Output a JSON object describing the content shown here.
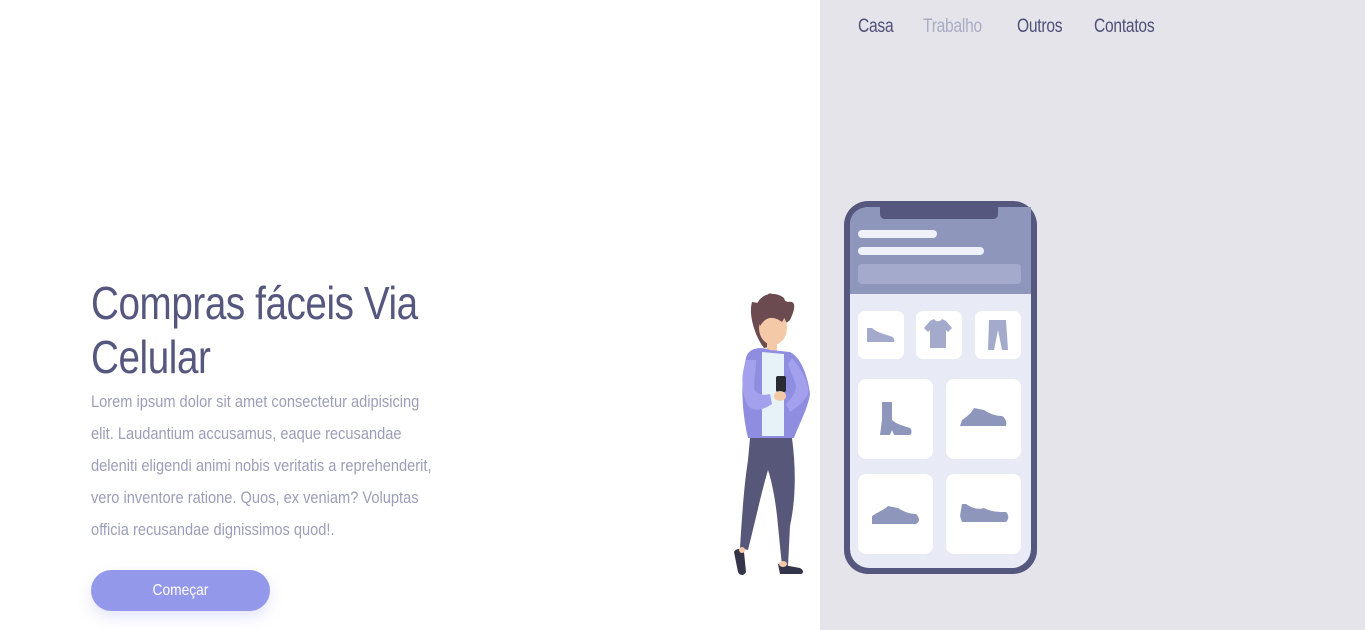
{
  "nav": {
    "items": [
      {
        "label": "Casa",
        "active": false
      },
      {
        "label": "Trabalho",
        "active": true
      },
      {
        "label": "Outros",
        "active": false
      },
      {
        "label": "Contatos",
        "active": false
      }
    ]
  },
  "hero": {
    "title": "Compras fáceis Via Celular",
    "description": "Lorem ipsum dolor sit amet consectetur adipisicing elit. Laudantium accusamus, eaque recusandae deleniti eligendi animi nobis veritatis a reprehenderit, vero inventore ratione. Quos, ex veniam? Voluptas officia recusandae dignissimos quod!.",
    "cta_label": "Começar"
  },
  "colors": {
    "accent": "#9398ea",
    "heading": "#55577f",
    "body_text": "#9c9eb9",
    "panel_bg": "#e5e4ea",
    "nav_active": "#a9acc4",
    "nav_default": "#4d5079"
  },
  "illustration": {
    "icons": [
      "woman-with-phone-icon",
      "smartphone-icon",
      "flat-shoe-icon",
      "tshirt-icon",
      "pants-icon",
      "boot-icon",
      "sneaker-icon"
    ]
  }
}
